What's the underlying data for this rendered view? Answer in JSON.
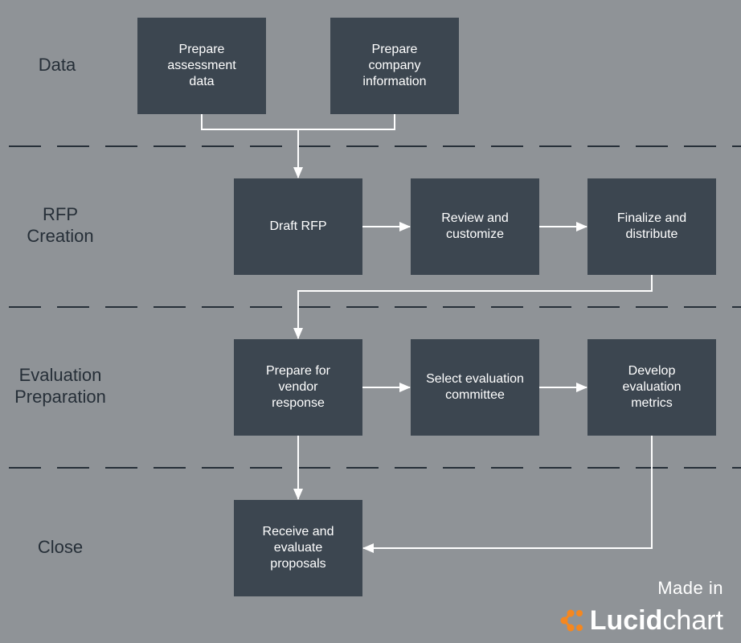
{
  "lanes": [
    {
      "id": "data",
      "label": "Data"
    },
    {
      "id": "rfp",
      "label": "RFP\nCreation"
    },
    {
      "id": "eval",
      "label": "Evaluation\nPreparation"
    },
    {
      "id": "close",
      "label": "Close"
    }
  ],
  "nodes": {
    "prep_assessment": "Prepare\nassessment\ndata",
    "prep_company": "Prepare\ncompany\ninformation",
    "draft_rfp": "Draft RFP",
    "review": "Review and\ncustomize",
    "finalize": "Finalize and\ndistribute",
    "prep_vendor": "Prepare for\nvendor\nresponse",
    "select_committee": "Select evaluation\ncommittee",
    "develop_metrics": "Develop\nevaluation\nmetrics",
    "receive": "Receive and\nevaluate\nproposals"
  },
  "edges": [
    {
      "from": "prep_assessment",
      "to": "draft_rfp"
    },
    {
      "from": "prep_company",
      "to": "draft_rfp"
    },
    {
      "from": "draft_rfp",
      "to": "review"
    },
    {
      "from": "review",
      "to": "finalize"
    },
    {
      "from": "finalize",
      "to": "prep_vendor"
    },
    {
      "from": "prep_vendor",
      "to": "select_committee"
    },
    {
      "from": "select_committee",
      "to": "develop_metrics"
    },
    {
      "from": "prep_vendor",
      "to": "receive"
    },
    {
      "from": "develop_metrics",
      "to": "receive"
    }
  ],
  "branding": {
    "made_in": "Made in",
    "logo_bold": "Lucid",
    "logo_light": "chart",
    "logo_icon": "lucidchart-logo-icon",
    "accent_color": "#f5871f"
  },
  "colors": {
    "background": "#8f9397",
    "box": "#3c4650",
    "divider": "#262f38",
    "connector": "#ffffff"
  }
}
